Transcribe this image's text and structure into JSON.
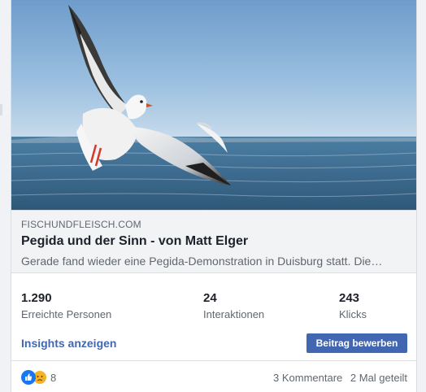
{
  "link_preview": {
    "domain": "FISCHUNDFLEISCH.COM",
    "title": "Pegida und der Sinn - von Matt Elger",
    "description": "Gerade fand wieder eine Pegida-Demonstration in Duisburg statt. Die…"
  },
  "stats": [
    {
      "value": "1.290",
      "label": "Erreichte Personen"
    },
    {
      "value": "24",
      "label": "Interaktionen"
    },
    {
      "value": "243",
      "label": "Klicks"
    }
  ],
  "actions": {
    "insights_label": "Insights anzeigen",
    "promote_label": "Beitrag bewerben"
  },
  "reactions": {
    "icons": [
      "like-icon",
      "sad-icon"
    ],
    "count": "8"
  },
  "footer": {
    "comments": "3 Kommentare",
    "shares": "2 Mal geteilt"
  },
  "colors": {
    "accent": "#4267b2",
    "sky": "#7ea6d0",
    "sea": "#3f6f95"
  }
}
